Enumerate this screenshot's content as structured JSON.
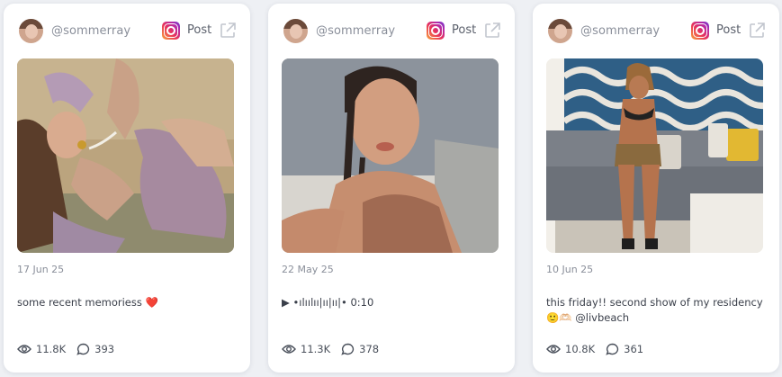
{
  "posts": [
    {
      "handle": "@sommerray",
      "platform_label": "Post",
      "date": "17 Jun 25",
      "caption": "some recent memoriess",
      "caption_emoji": "❤️",
      "views": "11.8K",
      "comments": "393",
      "photo_icon": "photo-woman-lilac-outfit"
    },
    {
      "handle": "@sommerray",
      "platform_label": "Post",
      "date": "22 May 25",
      "caption": "▶ •ılıılıı|ıı|ıı|• 0:10",
      "caption_emoji": "",
      "views": "11.3K",
      "comments": "378",
      "photo_icon": "photo-woman-braids"
    },
    {
      "handle": "@sommerray",
      "platform_label": "Post",
      "date": "10 Jun 25",
      "caption": "this friday!! second show of my residency",
      "caption_emoji": "🙂🫶🏻 @livbeach",
      "views": "10.8K",
      "comments": "361",
      "photo_icon": "photo-woman-bikini-couch"
    }
  ],
  "colors": {
    "background": "#eef0f4",
    "card": "#ffffff",
    "muted_text": "#8a8f9a"
  }
}
